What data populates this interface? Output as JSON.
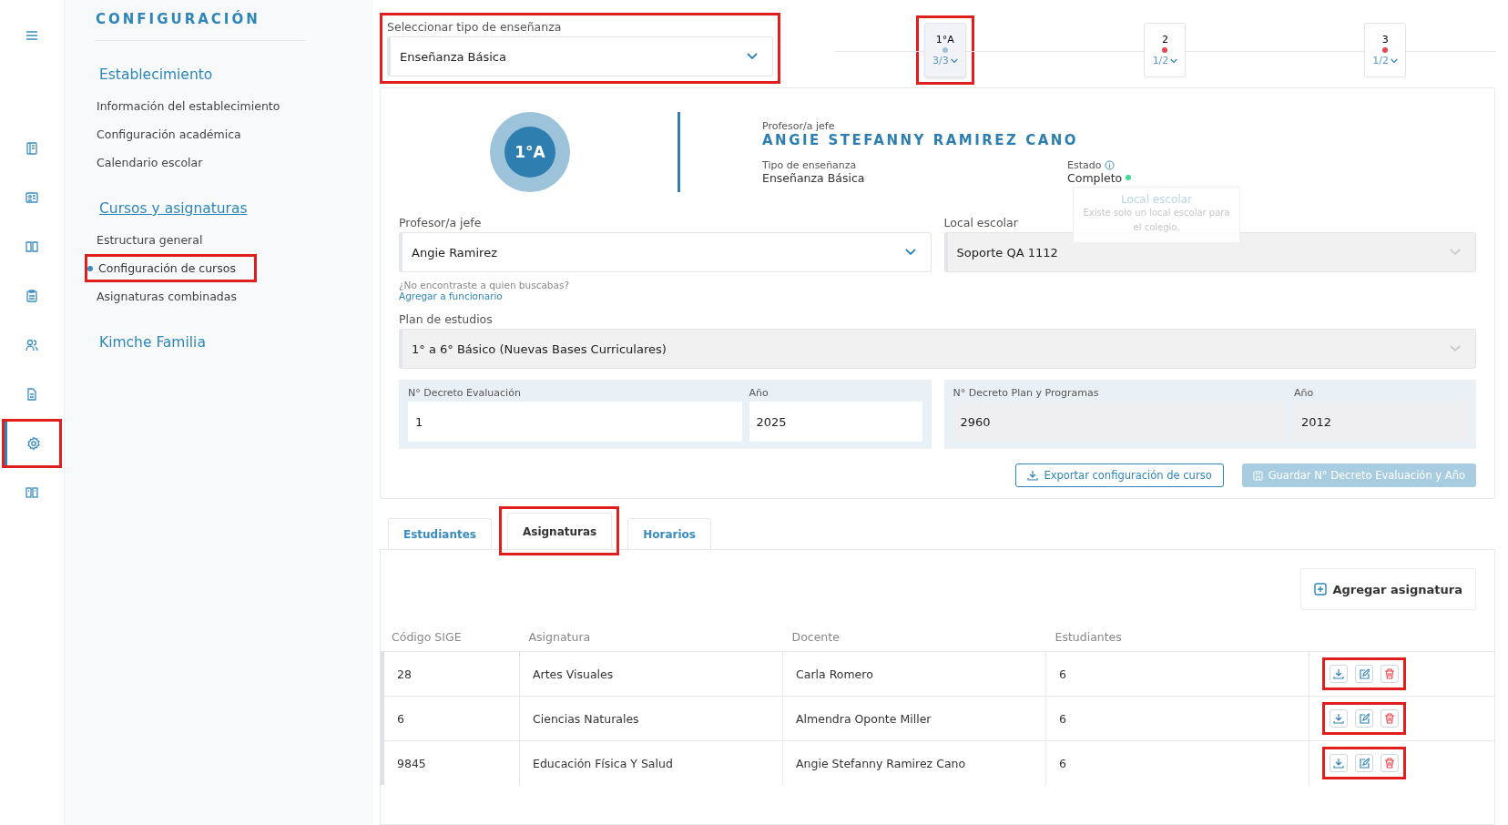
{
  "rail": {
    "items": [
      {
        "kind": "menu",
        "selected": false,
        "highlighted": false
      },
      {
        "kind": "book",
        "selected": false,
        "highlighted": false
      },
      {
        "kind": "card",
        "selected": false,
        "highlighted": false
      },
      {
        "kind": "open-book",
        "selected": false,
        "highlighted": false
      },
      {
        "kind": "clipboard",
        "selected": false,
        "highlighted": false
      },
      {
        "kind": "people",
        "selected": false,
        "highlighted": false
      },
      {
        "kind": "document",
        "selected": false,
        "highlighted": false
      },
      {
        "kind": "gear",
        "selected": true,
        "highlighted": true
      },
      {
        "kind": "books",
        "selected": false,
        "highlighted": false
      }
    ]
  },
  "sidebar": {
    "title": "CONFIGURACIÓN",
    "sections": [
      {
        "title": "Establecimiento",
        "selected": false,
        "items": [
          {
            "label": "Información del establecimiento",
            "selected": false,
            "highlighted": false
          },
          {
            "label": "Configuración académica",
            "selected": false,
            "highlighted": false
          },
          {
            "label": "Calendario escolar",
            "selected": false,
            "highlighted": false
          }
        ]
      },
      {
        "title": "Cursos y asignaturas",
        "selected": true,
        "items": [
          {
            "label": "Estructura general",
            "selected": false,
            "highlighted": false
          },
          {
            "label": "Configuración de cursos",
            "selected": true,
            "highlighted": true
          },
          {
            "label": "Asignaturas combinadas",
            "selected": false,
            "highlighted": false
          }
        ]
      },
      {
        "title": "Kimche Familia",
        "selected": false
      }
    ]
  },
  "type_select": {
    "label": "Seleccionar tipo de enseñanza",
    "value": "Enseñanza Básica",
    "highlighted": true
  },
  "courses": [
    {
      "name": "1°A",
      "count": "3/3",
      "color": "#9cc3da",
      "selected": true,
      "highlighted": true
    },
    {
      "name": "2",
      "count": "1/2",
      "color": "#e5484d",
      "selected": false,
      "highlighted": false
    },
    {
      "name": "3",
      "count": "1/2",
      "color": "#e5484d",
      "selected": false,
      "highlighted": false
    }
  ],
  "course_card": {
    "badge": "1°A",
    "head_label": "Profesor/a jefe",
    "head_name": "ANGIE STEFANNY RAMIREZ CANO",
    "type_label": "Tipo de enseñanza",
    "type_value": "Enseñanza Básica",
    "status_label": "Estado",
    "status_value": "Completo",
    "tooltip": {
      "title": "Local escolar",
      "text": "Existe solo un local escolar para el colegio."
    },
    "teacher": {
      "label": "Profesor/a jefe",
      "value": "Angie Ramirez",
      "hint": "¿No encontraste a quien buscabas?",
      "link": "Agregar a funcionario"
    },
    "location": {
      "label": "Local escolar",
      "value": "Soporte QA 1112",
      "disabled": true
    },
    "plan": {
      "label": "Plan de estudios",
      "value": "1° a 6° Básico (Nuevas Bases Curriculares)",
      "disabled": true
    },
    "decrees": [
      {
        "label": "N° Decreto Evaluación",
        "value": "1",
        "year_label": "Año",
        "year": "2025",
        "disabled": false
      },
      {
        "label": "N° Decreto Plan y Programas",
        "value": "2960",
        "year_label": "Año",
        "year": "2012",
        "disabled": true
      }
    ],
    "export_button": "Exportar configuración de curso",
    "save_button": {
      "label": "Guardar N° Decreto Evaluación y Año",
      "disabled": true
    }
  },
  "tabs": [
    {
      "label": "Estudiantes",
      "selected": false,
      "highlighted": false
    },
    {
      "label": "Asignaturas",
      "selected": true,
      "highlighted": true
    },
    {
      "label": "Horarios",
      "selected": false,
      "highlighted": false
    }
  ],
  "add_button": "Agregar asignatura",
  "table": {
    "columns": [
      "Código SIGE",
      "Asignatura",
      "Docente",
      "Estudiantes"
    ],
    "actions_highlighted": true,
    "rows": [
      [
        "28",
        "Artes Visuales",
        "Carla Romero",
        "6"
      ],
      [
        "6",
        "Ciencias Naturales",
        "Almendra Oponte Miller",
        "6"
      ],
      [
        "9845",
        "Educación Física Y Salud",
        "Angie Stefanny Ramirez Cano",
        "6"
      ]
    ]
  }
}
